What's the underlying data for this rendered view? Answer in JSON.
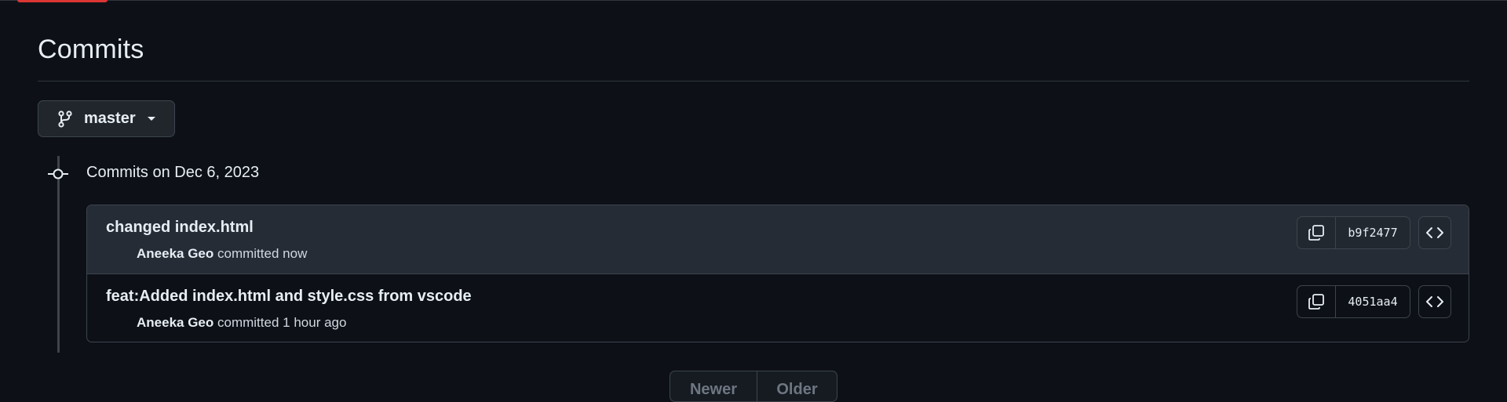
{
  "page": {
    "title": "Commits"
  },
  "branch": {
    "name": "master"
  },
  "commit_group": {
    "heading": "Commits on Dec 6, 2023"
  },
  "commits": [
    {
      "message": "changed index.html",
      "author": "Aneeka Geo",
      "verb": "committed",
      "time": "now",
      "sha": "b9f2477"
    },
    {
      "message": "feat:Added index.html and style.css from vscode",
      "author": "Aneeka Geo",
      "verb": "committed",
      "time": "1 hour ago",
      "sha": "4051aa4"
    }
  ],
  "pagination": {
    "newer_label": "Newer",
    "older_label": "Older"
  },
  "colors": {
    "background": "#0d1117",
    "border": "#3d444d",
    "highlight_row": "#262c36",
    "accent": "#da3633",
    "text": "#e6edf3",
    "disabled": "#6e7681"
  },
  "icons": {
    "branch": "git-branch-icon",
    "caret": "triangle-down-icon",
    "node": "git-commit-icon",
    "copy": "copy-icon",
    "browse": "code-icon"
  }
}
